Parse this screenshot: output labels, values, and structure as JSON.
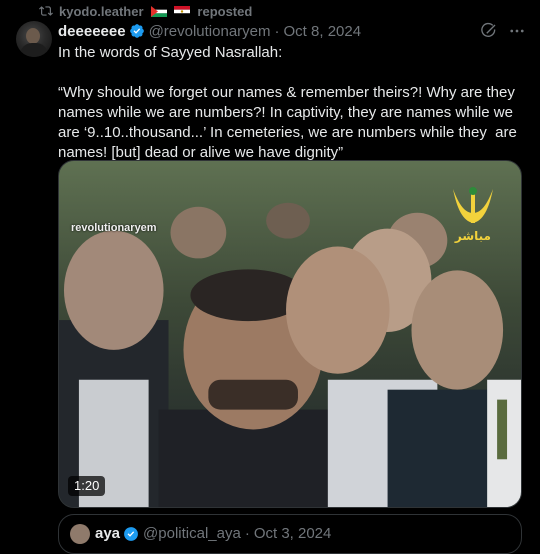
{
  "repost": {
    "reposter_name": "kyodo.leather",
    "action_label": "reposted",
    "icon": "repost-icon"
  },
  "tweet": {
    "display_name": "deeeeeee",
    "handle": "@revolutionaryem",
    "separator": "·",
    "date": "Oct 8, 2024",
    "text": "In the words of Sayyed Nasrallah:\n\n“Why should we forget our names & remember theirs?! Why are they names while we are numbers?! In captivity, they are names while we are ‘9..10..thousand...’ In cemeteries, we are numbers while they  are names! [but] dead or alive we have dignity”",
    "icons": [
      "verified-icon",
      "grok-icon",
      "more-icon"
    ]
  },
  "media": {
    "watermark": "revolutionaryem",
    "channel_text": "مباشر",
    "duration": "1:20",
    "colors": {
      "logo_yellow": "#f2d23c",
      "logo_green": "#2e8b3a"
    }
  },
  "quote": {
    "display_name": "aya",
    "handle": "@political_aya",
    "separator": "·",
    "date": "Oct 3, 2024"
  },
  "colors": {
    "background": "#000000",
    "text_primary": "#e7e9ea",
    "text_secondary": "#71767b",
    "border": "#2f3336",
    "verified_blue": "#1d9bf0"
  }
}
